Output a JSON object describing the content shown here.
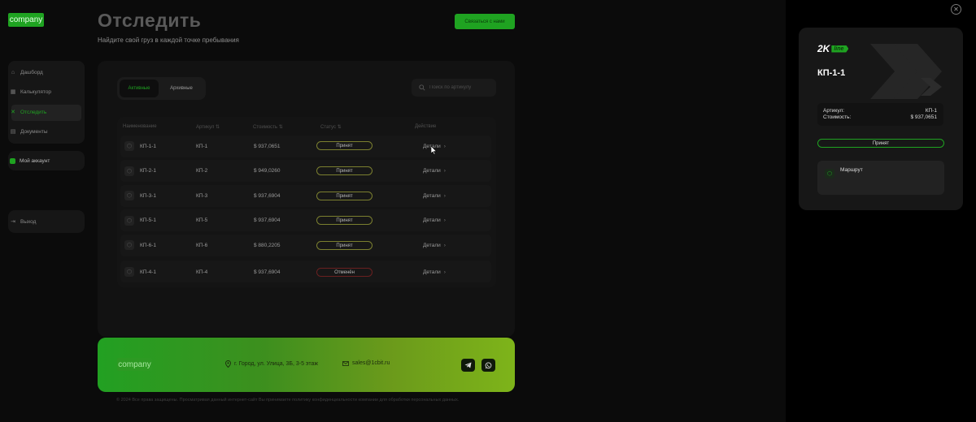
{
  "logo": "company",
  "header": {
    "title": "Отследить",
    "subtitle": "Найдите свой груз в каждой точке пребывания",
    "contact_button": "Связаться с нами"
  },
  "sidebar": {
    "items": [
      {
        "label": "Дашборд",
        "icon": "home-icon"
      },
      {
        "label": "Калькулятор",
        "icon": "calculator-icon"
      },
      {
        "label": "Отследить",
        "icon": "track-icon",
        "active": true
      },
      {
        "label": "Документы",
        "icon": "document-icon"
      }
    ],
    "account": "Мой аккаунт",
    "logout": "Выход"
  },
  "tabs": {
    "active": "Активные",
    "archive": "Архивные"
  },
  "search": {
    "placeholder": "Поиск по артикулу"
  },
  "table": {
    "headers": [
      "Наименование",
      "Артикул ⇅",
      "Стоимость ⇅",
      "Статус ⇅",
      "Действие"
    ],
    "rows": [
      {
        "name": "КП-1-1",
        "article": "КП-1",
        "cost": "$ 937,0651",
        "status": "Принят",
        "action": "Детали"
      },
      {
        "name": "КП-2-1",
        "article": "КП-2",
        "cost": "$ 949,0260",
        "status": "Принят",
        "action": "Детали"
      },
      {
        "name": "КП-3-1",
        "article": "КП-3",
        "cost": "$ 937,6904",
        "status": "Принят",
        "action": "Детали"
      },
      {
        "name": "КП-5-1",
        "article": "КП-5",
        "cost": "$ 937,6904",
        "status": "Принят",
        "action": "Детали"
      },
      {
        "name": "КП-6-1",
        "article": "КП-6",
        "cost": "$ 880,2205",
        "status": "Принят",
        "action": "Детали"
      },
      {
        "name": "КП-4-1",
        "article": "КП-4",
        "cost": "$ 937,6904",
        "status": "Отменён",
        "action": "Детали"
      }
    ]
  },
  "footer": {
    "logo": "company",
    "address": "г. Город, ул. Улица, 3Б, 3-5 этаж",
    "email": "sales@1cbit.ru",
    "copyright": "© 2024 Все права защищены. Просматривая данный интернет-сайт Вы принимаете политику конфиденциальности компании для обработки персональных данных."
  },
  "panel": {
    "brand_main": "2K",
    "brand_line": "line",
    "title": "КП-1-1",
    "article_label": "Артикул:",
    "article_value": "КП-1",
    "cost_label": "Стоимость:",
    "cost_value": "$ 937,0651",
    "status": "Принят",
    "route_label": "Маршрут"
  },
  "colors": {
    "accent": "#1fa321",
    "status_ok_border": "#7b7f2f",
    "status_cancel_border": "#6a2020"
  }
}
